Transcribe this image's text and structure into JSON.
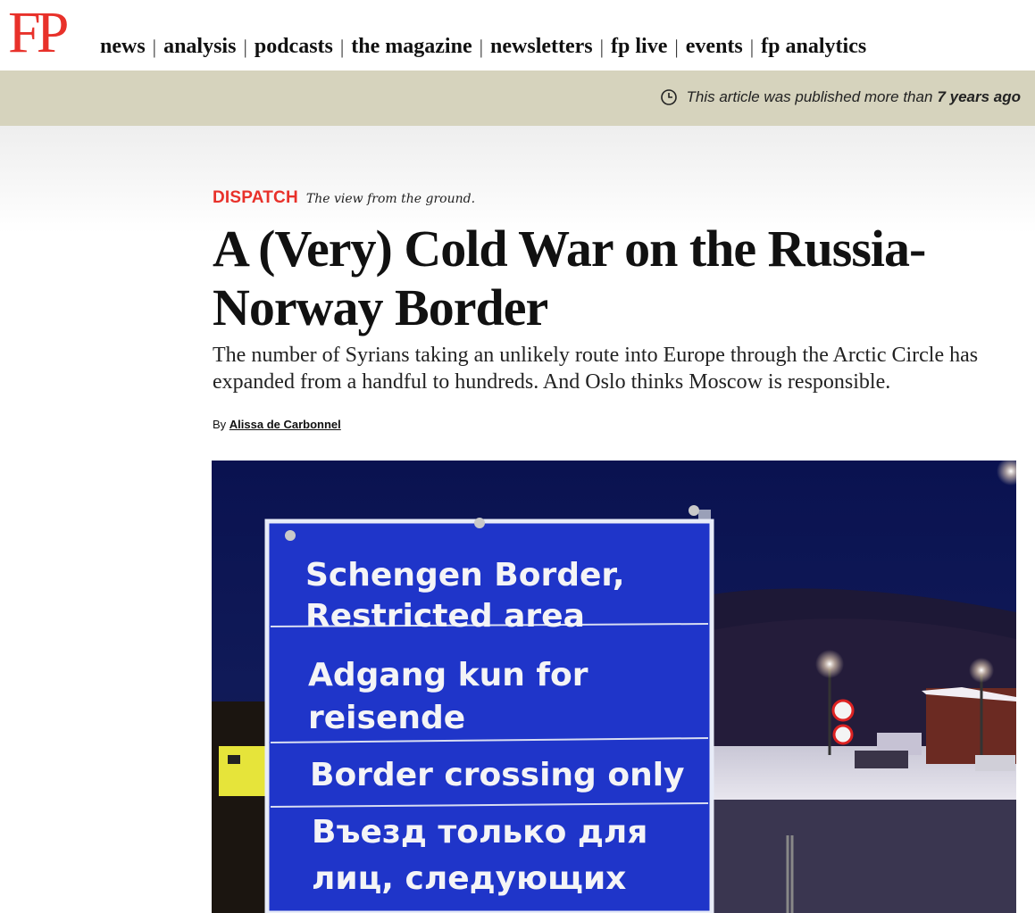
{
  "header": {
    "logo": "FP",
    "nav": [
      "news",
      "analysis",
      "podcasts",
      "the magazine",
      "newsletters",
      "fp live",
      "events",
      "fp analytics"
    ]
  },
  "banner": {
    "text": "This article was published more than",
    "emphasis": "7 years ago"
  },
  "article": {
    "kicker": "DISPATCH",
    "kicker_sub": "The view from the ground.",
    "title": "A (Very) Cold War on the Russia-Norway Border",
    "dek": "The number of Syrians taking an unlikely route into Europe through the Arctic Circle has expanded from a handful to hundreds. And Oslo thinks Moscow is responsible.",
    "byline_prefix": "By",
    "author": "Alissa de Carbonnel"
  },
  "photo": {
    "sign_lines": [
      "Schengen Border,",
      "Restricted area",
      "Adgang kun for",
      "reisende",
      "Border crossing only",
      "Въезд только для",
      "лиц, следующих"
    ]
  },
  "colors": {
    "brand_red": "#e8312a",
    "banner_bg": "#d6d3bd",
    "sign_blue": "#1f35c9"
  }
}
